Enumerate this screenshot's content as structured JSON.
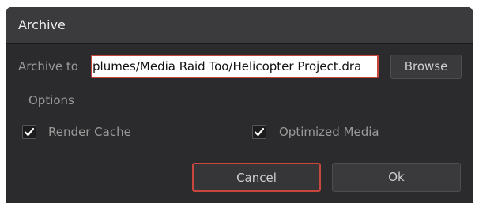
{
  "dialog": {
    "title": "Archive",
    "archive_to_label": "Archive to",
    "archive_path": "plumes/Media Raid Too/Helicopter Project.dra",
    "browse_label": "Browse",
    "options_label": "Options",
    "options": [
      {
        "label": "Render Cache",
        "checked": true
      },
      {
        "label": "Optimized Media",
        "checked": true
      }
    ],
    "cancel_label": "Cancel",
    "ok_label": "Ok"
  },
  "colors": {
    "accent": "#c8473c",
    "panel": "#2b2b2d",
    "titlebar": "#3b3b3e"
  }
}
